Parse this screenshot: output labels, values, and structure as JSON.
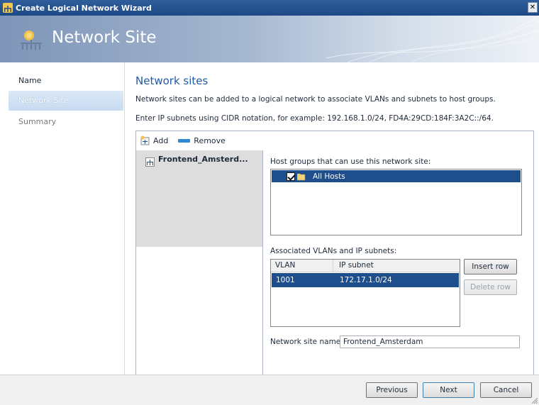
{
  "window": {
    "title": "Create Logical Network Wizard",
    "close_glyph": "✕"
  },
  "banner": {
    "title": "Network Site",
    "icon": "network-site-icon"
  },
  "nav": {
    "items": [
      {
        "label": "Name",
        "state": "normal"
      },
      {
        "label": "Network Site",
        "state": "active"
      },
      {
        "label": "Summary",
        "state": "inactive"
      }
    ]
  },
  "page": {
    "title": "Network sites",
    "description": "Network sites can be added to a logical network to associate VLANs and subnets to host groups.",
    "cidr_hint": "Enter IP subnets using CIDR notation, for example: 192.168.1.0/24, FD4A:29CD:184F:3A2C::/64."
  },
  "toolbar": {
    "add_label": "Add",
    "remove_label": "Remove"
  },
  "sites": [
    {
      "name": "Frontend_Amsterd..."
    }
  ],
  "detail": {
    "host_groups_label": "Host groups that can use this network site:",
    "host_groups": [
      {
        "name": "All Hosts",
        "checked": true
      }
    ],
    "vlans_label": "Associated VLANs and IP subnets:",
    "vlan_columns": [
      "VLAN",
      "IP subnet"
    ],
    "vlan_rows": [
      {
        "vlan": "1001",
        "subnet": "172.17.1.0/24"
      }
    ],
    "insert_row_label": "Insert row",
    "delete_row_label": "Delete row",
    "site_name_label": "Network site name:",
    "site_name_value": "Frontend_Amsterdam"
  },
  "footer": {
    "previous_label": "Previous",
    "next_label": "Next",
    "cancel_label": "Cancel"
  },
  "colors": {
    "accent": "#1e5aa8",
    "selection": "#1f4e8c",
    "titlebar": "#2f5e9c"
  }
}
